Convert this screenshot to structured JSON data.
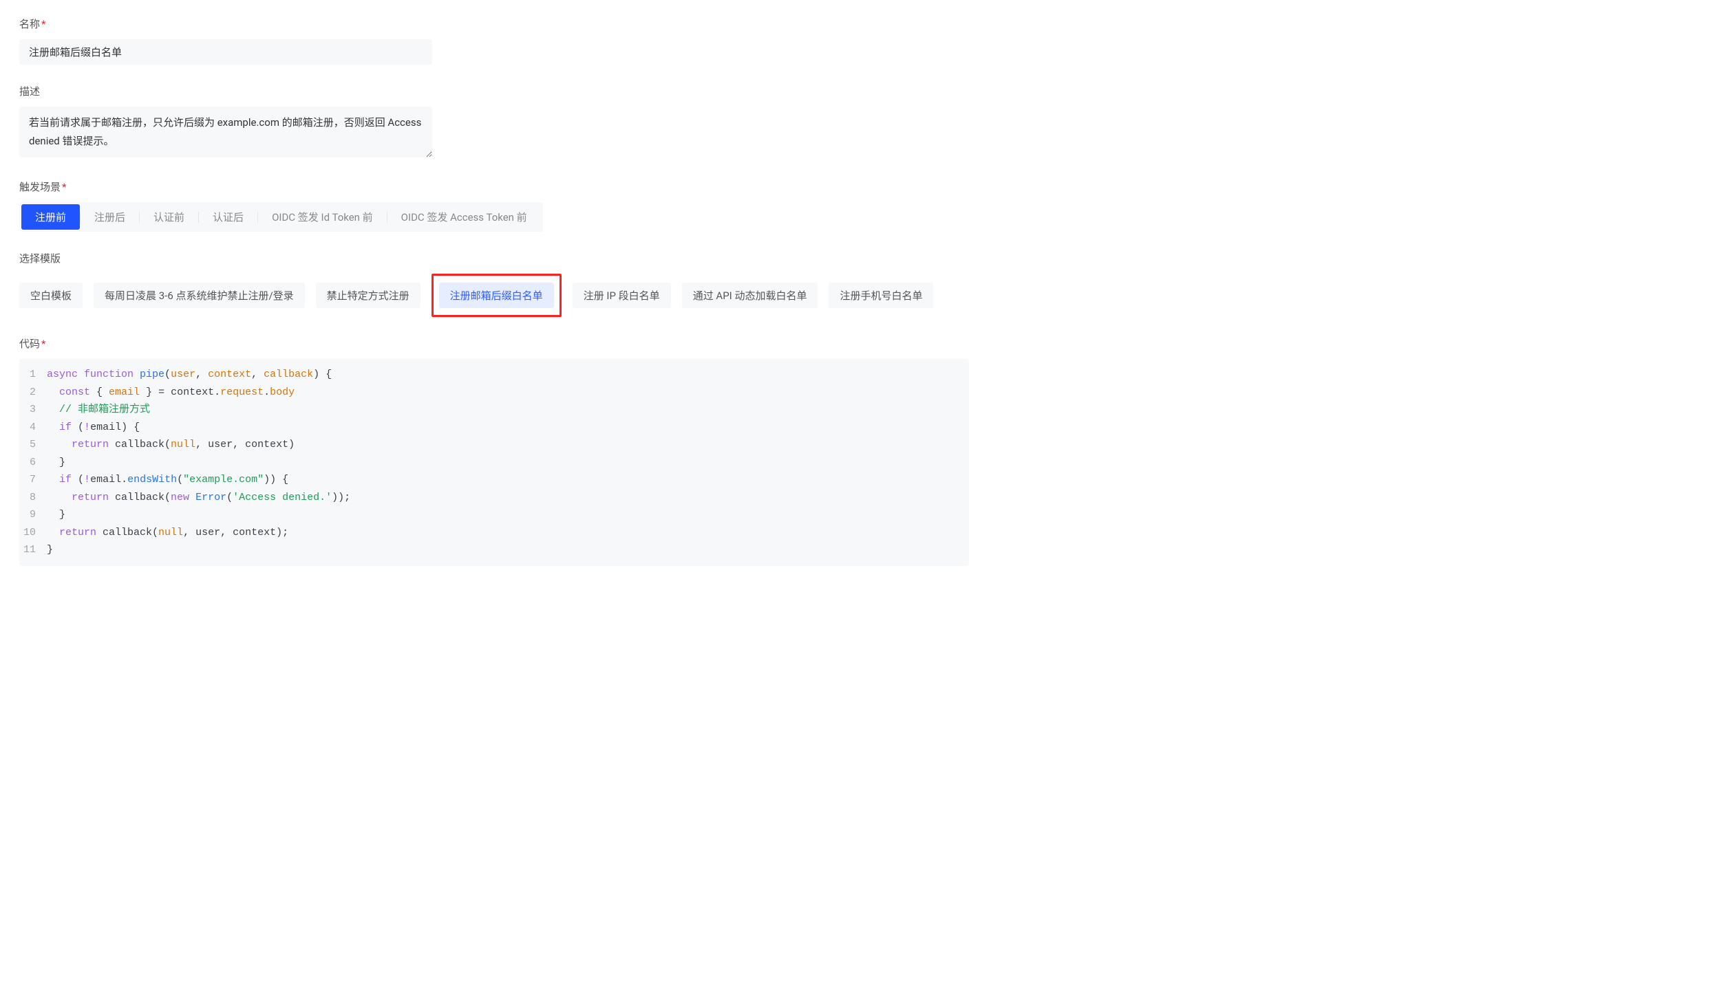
{
  "fields": {
    "name": {
      "label": "名称",
      "value": "注册邮箱后缀白名单",
      "required": true
    },
    "description": {
      "label": "描述",
      "value": "若当前请求属于邮箱注册，只允许后缀为 example.com 的邮箱注册，否则返回 Access denied 错误提示。",
      "required": false
    },
    "trigger": {
      "label": "触发场景",
      "required": true,
      "options": [
        "注册前",
        "注册后",
        "认证前",
        "认证后",
        "OIDC 签发 Id Token 前",
        "OIDC 签发 Access Token 前"
      ],
      "selected_index": 0
    },
    "template": {
      "label": "选择模版",
      "options": [
        "空白模板",
        "每周日凌晨 3-6 点系统维护禁止注册/登录",
        "禁止特定方式注册",
        "注册邮箱后缀白名单",
        "注册 IP 段白名单",
        "通过 API 动态加载白名单",
        "注册手机号白名单"
      ],
      "selected_index": 3,
      "highlighted_index": 3
    },
    "code": {
      "label": "代码",
      "required": true,
      "lines": [
        {
          "num": "1",
          "tokens": [
            [
              "kw",
              "async "
            ],
            [
              "kw",
              "function "
            ],
            [
              "fn",
              "pipe"
            ],
            [
              "text",
              "("
            ],
            [
              "param",
              "user"
            ],
            [
              "text",
              ", "
            ],
            [
              "param",
              "context"
            ],
            [
              "text",
              ", "
            ],
            [
              "param",
              "callback"
            ],
            [
              "text",
              ") {"
            ]
          ]
        },
        {
          "num": "2",
          "tokens": [
            [
              "text",
              "  "
            ],
            [
              "kw",
              "const"
            ],
            [
              "text",
              " { "
            ],
            [
              "prop",
              "email"
            ],
            [
              "text",
              " } = context."
            ],
            [
              "prop",
              "request"
            ],
            [
              "text",
              "."
            ],
            [
              "prop",
              "body"
            ]
          ]
        },
        {
          "num": "3",
          "tokens": [
            [
              "text",
              "  "
            ],
            [
              "comment",
              "// 非邮箱注册方式"
            ]
          ]
        },
        {
          "num": "4",
          "tokens": [
            [
              "text",
              "  "
            ],
            [
              "kw",
              "if"
            ],
            [
              "text",
              " ("
            ],
            [
              "kw",
              "!"
            ],
            [
              "text",
              "email) {"
            ]
          ]
        },
        {
          "num": "5",
          "tokens": [
            [
              "text",
              "    "
            ],
            [
              "kw",
              "return"
            ],
            [
              "text",
              " callback("
            ],
            [
              "bool",
              "null"
            ],
            [
              "text",
              ", user, context)"
            ]
          ]
        },
        {
          "num": "6",
          "tokens": [
            [
              "text",
              "  }"
            ]
          ]
        },
        {
          "num": "7",
          "tokens": [
            [
              "text",
              "  "
            ],
            [
              "kw",
              "if"
            ],
            [
              "text",
              " ("
            ],
            [
              "kw",
              "!"
            ],
            [
              "text",
              "email."
            ],
            [
              "fn",
              "endsWith"
            ],
            [
              "text",
              "("
            ],
            [
              "str",
              "\"example.com\""
            ],
            [
              "text",
              ")) {"
            ]
          ]
        },
        {
          "num": "8",
          "tokens": [
            [
              "text",
              "    "
            ],
            [
              "kw",
              "return"
            ],
            [
              "text",
              " callback("
            ],
            [
              "kw",
              "new"
            ],
            [
              "text",
              " "
            ],
            [
              "cls",
              "Error"
            ],
            [
              "text",
              "("
            ],
            [
              "str",
              "'Access denied.'"
            ],
            [
              "text",
              "));"
            ]
          ]
        },
        {
          "num": "9",
          "tokens": [
            [
              "text",
              "  }"
            ]
          ]
        },
        {
          "num": "10",
          "tokens": [
            [
              "text",
              "  "
            ],
            [
              "kw",
              "return"
            ],
            [
              "text",
              " callback("
            ],
            [
              "bool",
              "null"
            ],
            [
              "text",
              ", user, context);"
            ]
          ]
        },
        {
          "num": "11",
          "tokens": [
            [
              "text",
              "}"
            ]
          ]
        }
      ]
    }
  }
}
